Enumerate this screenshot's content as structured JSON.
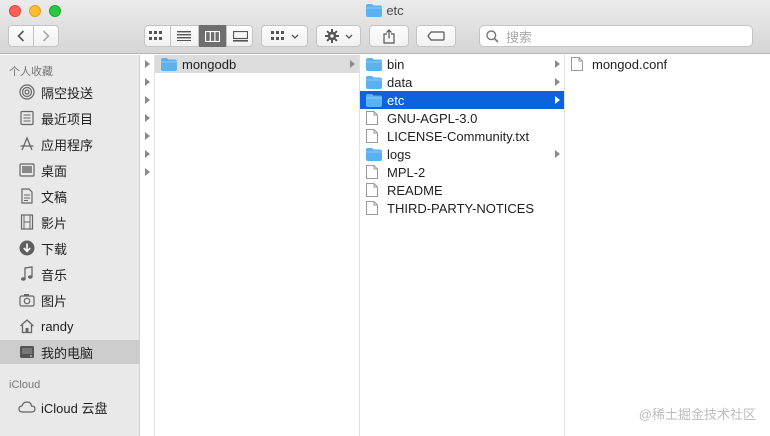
{
  "window": {
    "title": "etc"
  },
  "toolbar": {
    "search_placeholder": "搜索"
  },
  "sidebar": {
    "favorites_header": "个人收藏",
    "items": [
      {
        "label": "隔空投送",
        "icon": "airdrop-icon"
      },
      {
        "label": "最近项目",
        "icon": "recents-icon"
      },
      {
        "label": "应用程序",
        "icon": "applications-icon"
      },
      {
        "label": "桌面",
        "icon": "desktop-icon"
      },
      {
        "label": "文稿",
        "icon": "documents-icon"
      },
      {
        "label": "影片",
        "icon": "movies-icon"
      },
      {
        "label": "下载",
        "icon": "downloads-icon"
      },
      {
        "label": "音乐",
        "icon": "music-icon"
      },
      {
        "label": "图片",
        "icon": "pictures-icon"
      },
      {
        "label": "randy",
        "icon": "home-icon"
      },
      {
        "label": "我的电脑",
        "icon": "computer-icon"
      }
    ],
    "icloud_header": "iCloud",
    "icloud_items": [
      {
        "label": "iCloud 云盘",
        "icon": "cloud-icon"
      }
    ]
  },
  "columns": {
    "col1": [
      {
        "name": "mongodb",
        "type": "folder"
      }
    ],
    "col2": [
      {
        "name": "bin",
        "type": "folder"
      },
      {
        "name": "data",
        "type": "folder"
      },
      {
        "name": "etc",
        "type": "folder"
      },
      {
        "name": "GNU-AGPL-3.0",
        "type": "file"
      },
      {
        "name": "LICENSE-Community.txt",
        "type": "file"
      },
      {
        "name": "logs",
        "type": "folder"
      },
      {
        "name": "MPL-2",
        "type": "file"
      },
      {
        "name": "README",
        "type": "file"
      },
      {
        "name": "THIRD-PARTY-NOTICES",
        "type": "file"
      }
    ],
    "col3": [
      {
        "name": "mongod.conf",
        "type": "file"
      }
    ]
  },
  "watermark": "@稀土掘金技术社区",
  "colors": {
    "selection_blue": "#0d63de",
    "folder_blue": "#5ab2f0"
  }
}
